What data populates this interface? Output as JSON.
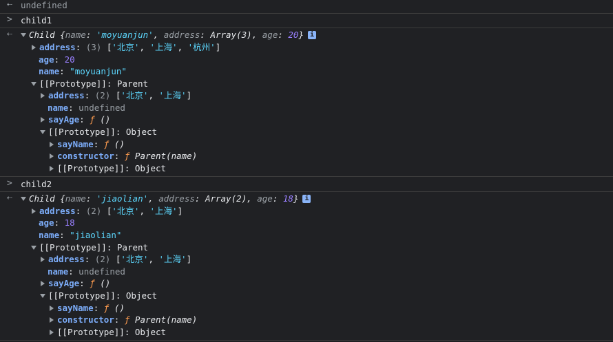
{
  "glyphs": {
    "output": "⇠",
    "input": ">"
  },
  "header": {
    "text": "undefined"
  },
  "child1": {
    "input": "child1",
    "summary": {
      "class_name": "Child",
      "name_key": "name",
      "name_val": "'moyuanjun'",
      "address_key": "address",
      "address_val": "Array(3)",
      "age_key": "age",
      "age_val": "20",
      "info": "i"
    },
    "address": {
      "key": "address",
      "count": "(3)",
      "items": [
        "'北京'",
        "'上海'",
        "'杭州'"
      ]
    },
    "age": {
      "key": "age",
      "value": "20"
    },
    "name": {
      "key": "name",
      "value": "\"moyuanjun\""
    },
    "proto": {
      "label": "[[Prototype]]",
      "type": "Parent",
      "address": {
        "key": "address",
        "count": "(2)",
        "items": [
          "'北京'",
          "'上海'"
        ]
      },
      "name": {
        "key": "name",
        "value": "undefined"
      },
      "sayAge": {
        "key": "sayAge",
        "f": "ƒ",
        "sig": "()"
      },
      "proto": {
        "label": "[[Prototype]]",
        "type": "Object",
        "sayName": {
          "key": "sayName",
          "f": "ƒ",
          "sig": "()"
        },
        "constructor": {
          "key": "constructor",
          "f": "ƒ",
          "sig": "Parent(name)"
        },
        "proto": {
          "label": "[[Prototype]]",
          "type": "Object"
        }
      }
    }
  },
  "child2": {
    "input": "child2",
    "summary": {
      "class_name": "Child",
      "name_key": "name",
      "name_val": "'jiaolian'",
      "address_key": "address",
      "address_val": "Array(2)",
      "age_key": "age",
      "age_val": "18",
      "info": "i"
    },
    "address": {
      "key": "address",
      "count": "(2)",
      "items": [
        "'北京'",
        "'上海'"
      ]
    },
    "age": {
      "key": "age",
      "value": "18"
    },
    "name": {
      "key": "name",
      "value": "\"jiaolian\""
    },
    "proto": {
      "label": "[[Prototype]]",
      "type": "Parent",
      "address": {
        "key": "address",
        "count": "(2)",
        "items": [
          "'北京'",
          "'上海'"
        ]
      },
      "name": {
        "key": "name",
        "value": "undefined"
      },
      "sayAge": {
        "key": "sayAge",
        "f": "ƒ",
        "sig": "()"
      },
      "proto": {
        "label": "[[Prototype]]",
        "type": "Object",
        "sayName": {
          "key": "sayName",
          "f": "ƒ",
          "sig": "()"
        },
        "constructor": {
          "key": "constructor",
          "f": "ƒ",
          "sig": "Parent(name)"
        },
        "proto": {
          "label": "[[Prototype]]",
          "type": "Object"
        }
      }
    }
  }
}
